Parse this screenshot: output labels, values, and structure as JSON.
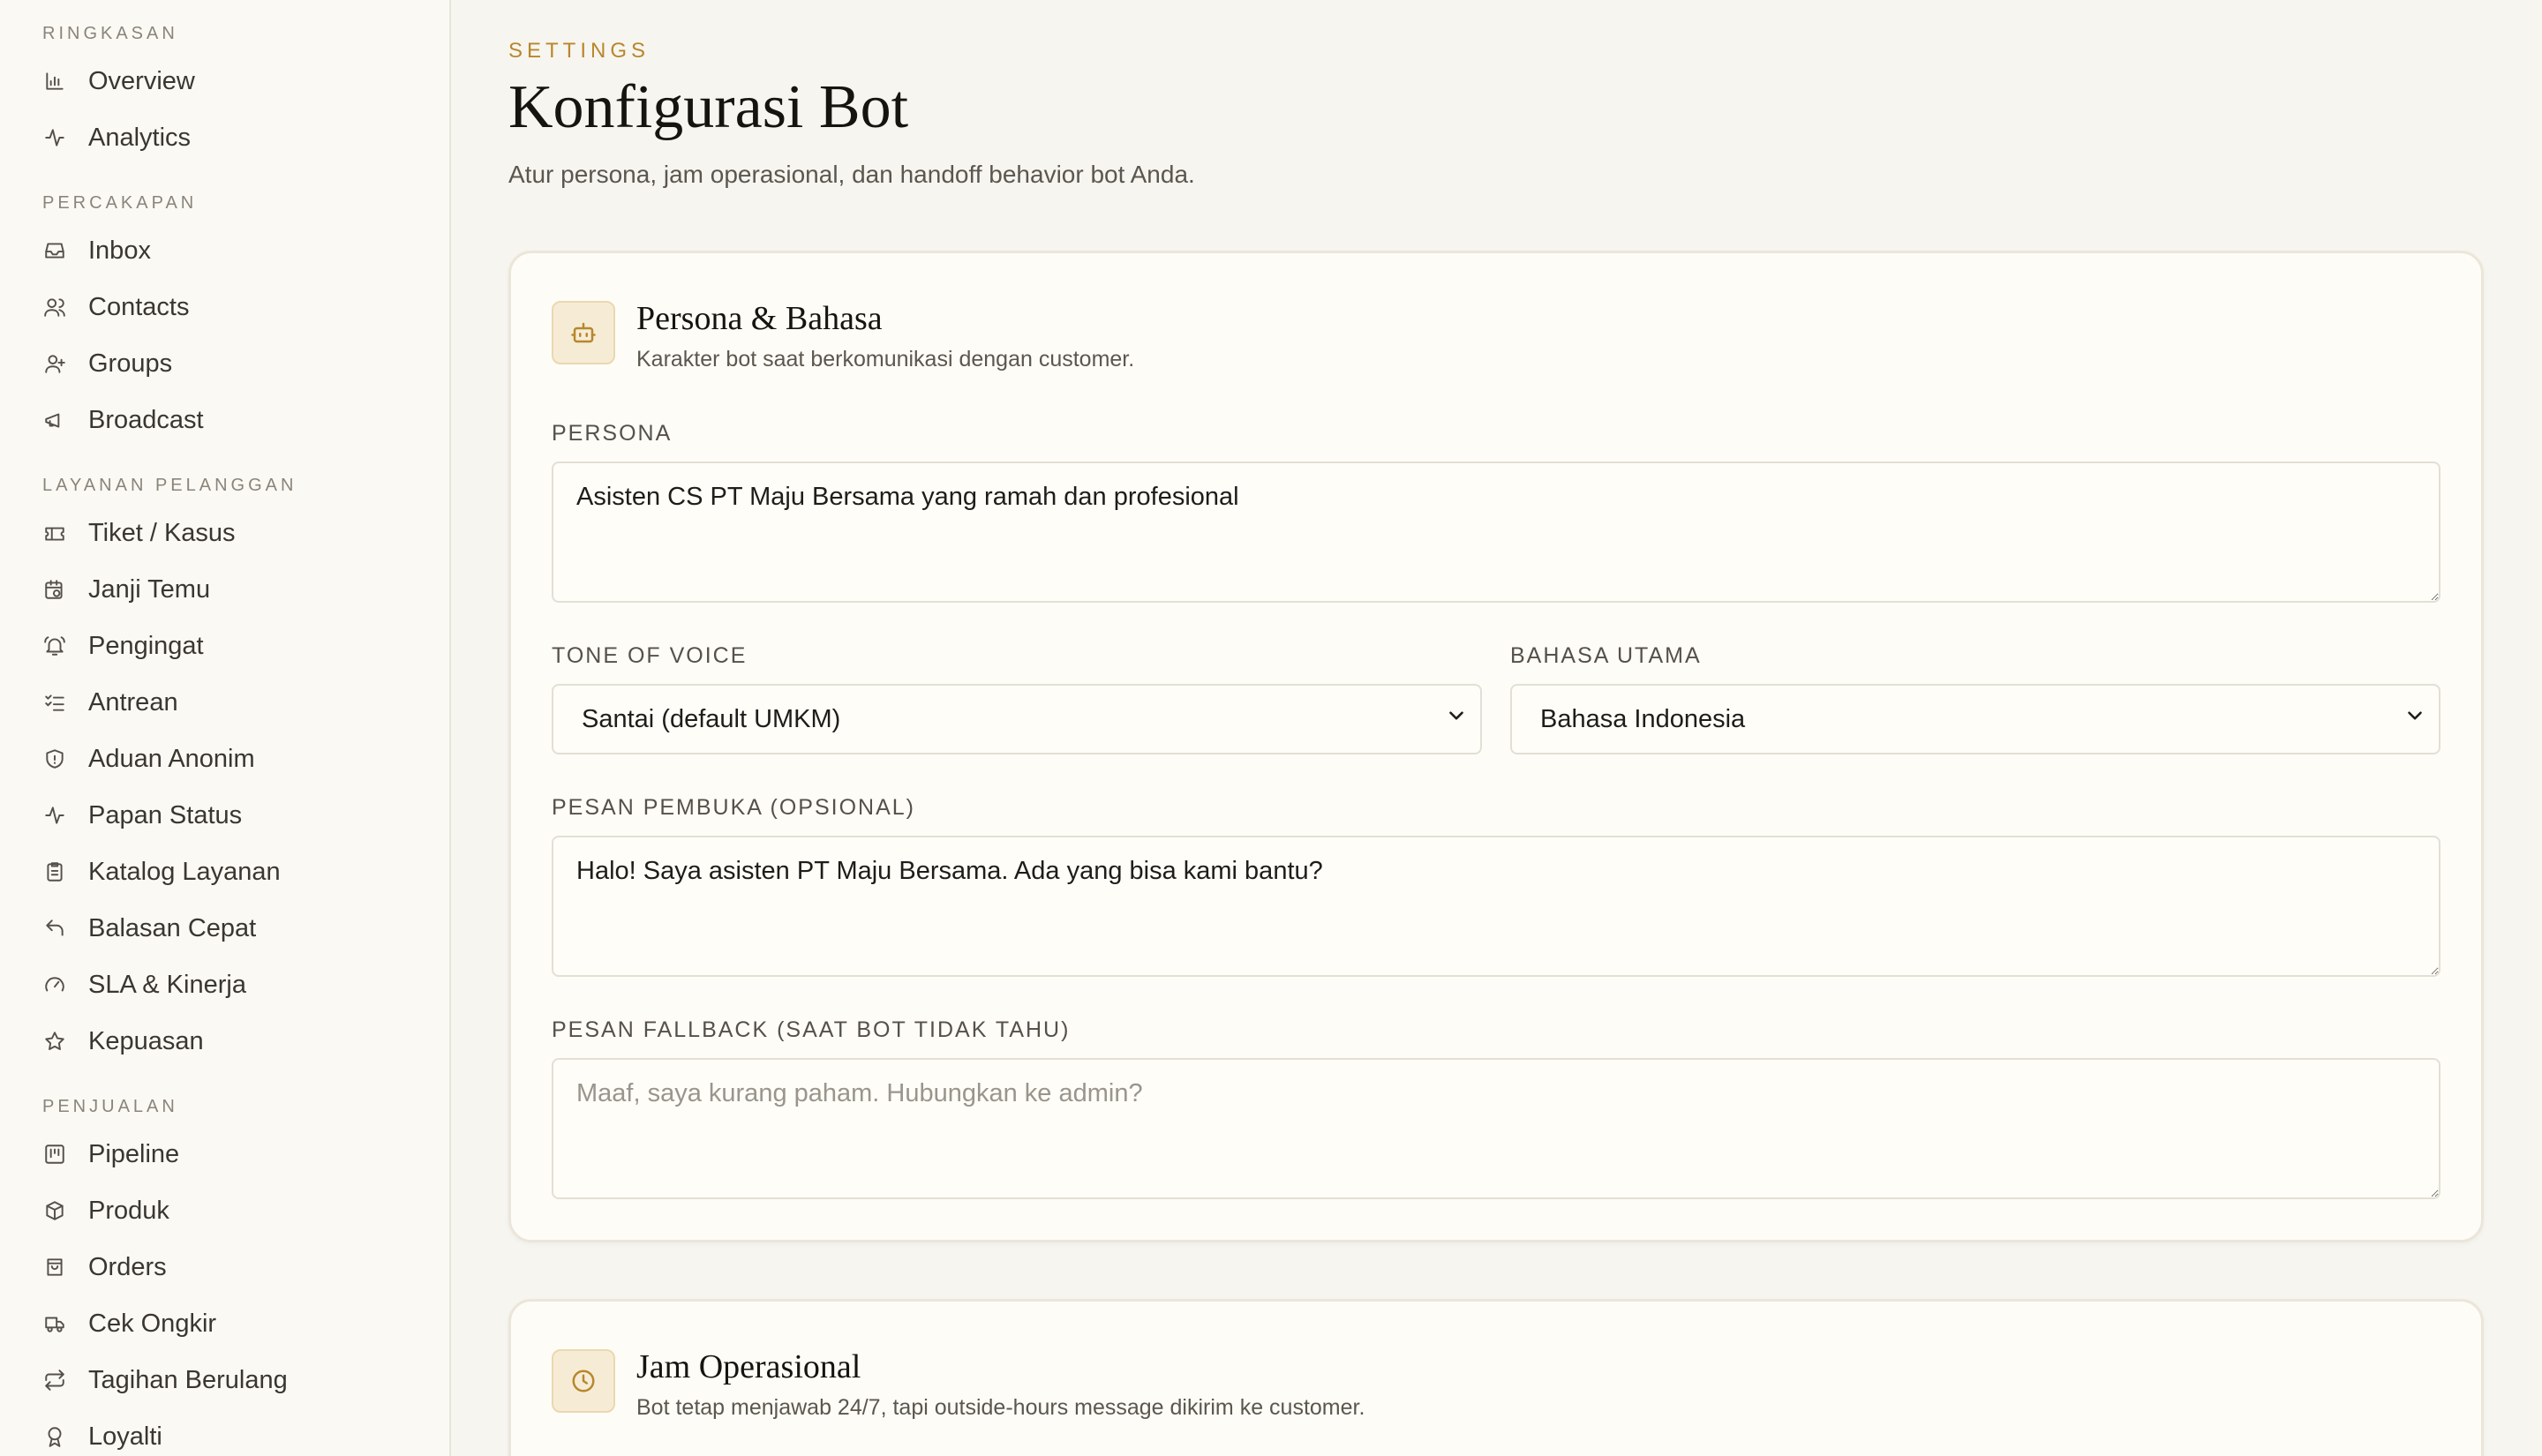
{
  "sidebar": {
    "sections": [
      {
        "label": "RINGKASAN",
        "items": [
          {
            "label": "Overview",
            "icon": "bar-chart-icon"
          },
          {
            "label": "Analytics",
            "icon": "activity-icon"
          }
        ]
      },
      {
        "label": "PERCAKAPAN",
        "items": [
          {
            "label": "Inbox",
            "icon": "inbox-icon"
          },
          {
            "label": "Contacts",
            "icon": "users-icon"
          },
          {
            "label": "Groups",
            "icon": "group-icon"
          },
          {
            "label": "Broadcast",
            "icon": "megaphone-icon"
          }
        ]
      },
      {
        "label": "LAYANAN PELANGGAN",
        "items": [
          {
            "label": "Tiket / Kasus",
            "icon": "ticket-icon"
          },
          {
            "label": "Janji Temu",
            "icon": "calendar-clock-icon"
          },
          {
            "label": "Pengingat",
            "icon": "bell-ring-icon"
          },
          {
            "label": "Antrean",
            "icon": "list-checks-icon"
          },
          {
            "label": "Aduan Anonim",
            "icon": "shield-icon"
          },
          {
            "label": "Papan Status",
            "icon": "activity-icon"
          },
          {
            "label": "Katalog Layanan",
            "icon": "clipboard-list-icon"
          },
          {
            "label": "Balasan Cepat",
            "icon": "reply-icon"
          },
          {
            "label": "SLA & Kinerja",
            "icon": "gauge-icon"
          },
          {
            "label": "Kepuasan",
            "icon": "star-icon"
          }
        ]
      },
      {
        "label": "PENJUALAN",
        "items": [
          {
            "label": "Pipeline",
            "icon": "kanban-icon"
          },
          {
            "label": "Produk",
            "icon": "package-icon"
          },
          {
            "label": "Orders",
            "icon": "shopping-bag-icon"
          },
          {
            "label": "Cek Ongkir",
            "icon": "truck-icon"
          },
          {
            "label": "Tagihan Berulang",
            "icon": "repeat-icon"
          },
          {
            "label": "Loyalti",
            "icon": "award-icon"
          }
        ]
      }
    ]
  },
  "header": {
    "eyebrow": "SETTINGS",
    "title": "Konfigurasi Bot",
    "subtitle": "Atur persona, jam operasional, dan handoff behavior bot Anda."
  },
  "persona_card": {
    "title": "Persona & Bahasa",
    "description": "Karakter bot saat berkomunikasi dengan customer.",
    "persona_label": "PERSONA",
    "persona_value": "Asisten CS PT Maju Bersama yang ramah dan profesional",
    "tone_label": "TONE OF VOICE",
    "tone_value": "Santai (default UMKM)",
    "language_label": "BAHASA UTAMA",
    "language_value": "Bahasa Indonesia",
    "opening_label": "PESAN PEMBUKA (OPSIONAL)",
    "opening_value": "Halo! Saya asisten PT Maju Bersama. Ada yang bisa kami bantu?",
    "fallback_label": "PESAN FALLBACK (SAAT BOT TIDAK TAHU)",
    "fallback_placeholder": "Maaf, saya kurang paham. Hubungkan ke admin?"
  },
  "hours_card": {
    "title": "Jam Operasional",
    "description": "Bot tetap menjawab 24/7, tapi outside-hours message dikirim ke customer."
  },
  "colors": {
    "accent": "#b8872c",
    "background": "#f7f5f0",
    "card": "#fefcf6"
  }
}
